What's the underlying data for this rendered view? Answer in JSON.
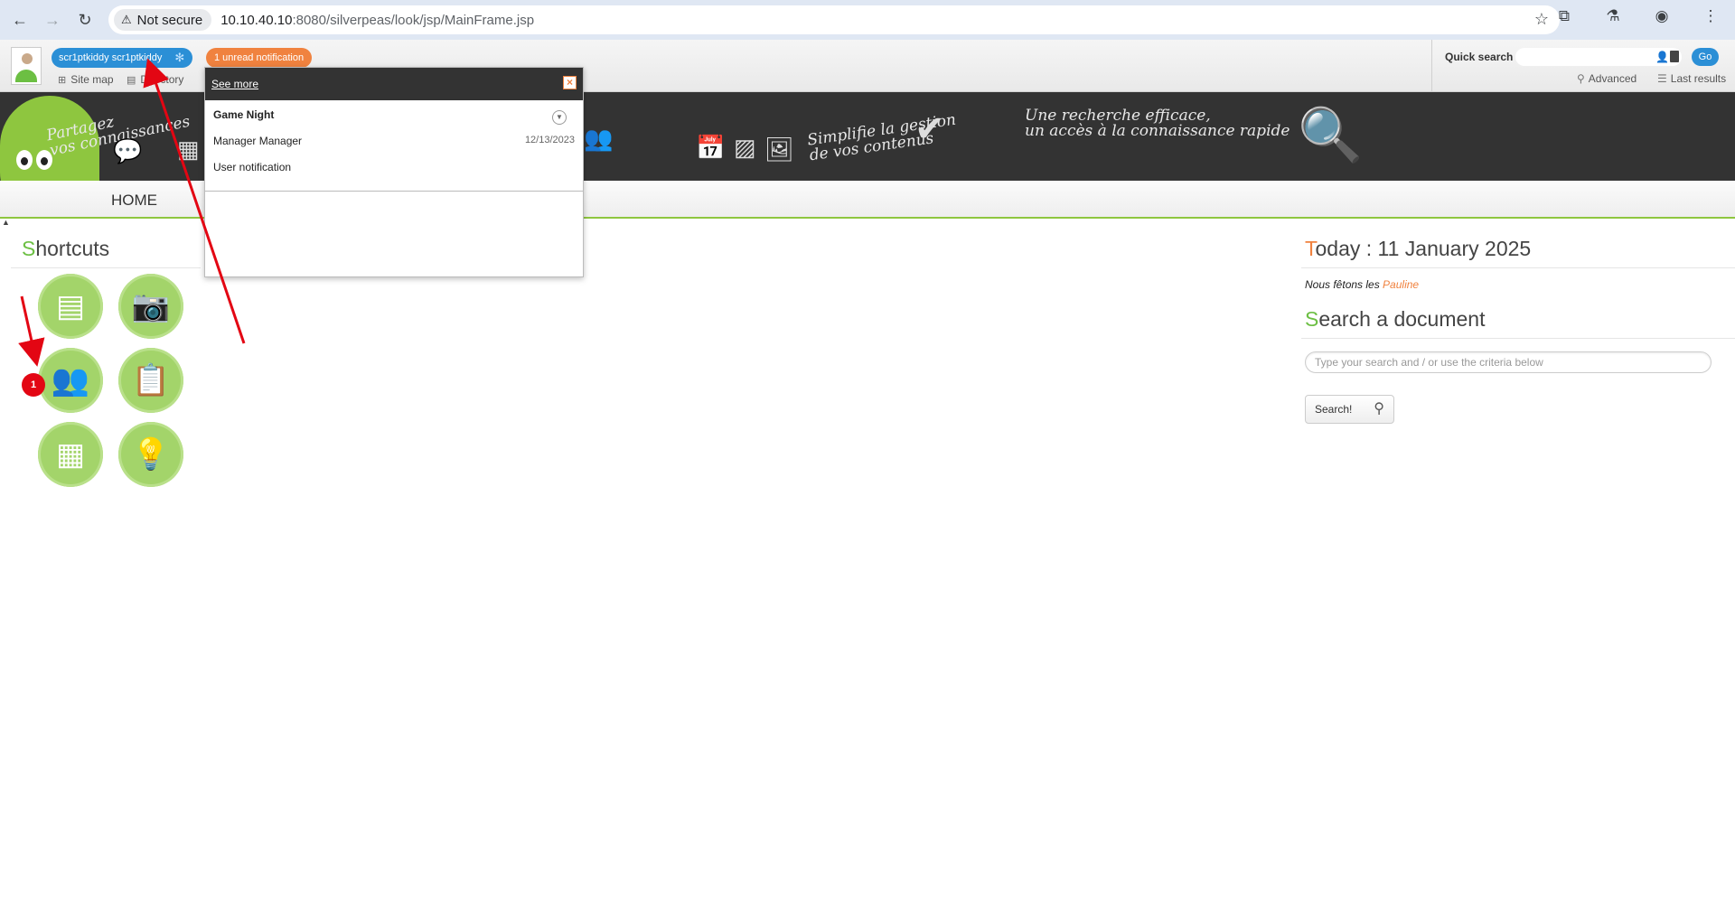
{
  "browser": {
    "security_label": "Not secure",
    "url_host": "10.10.40.10",
    "url_rest": ":8080/silverpeas/look/jsp/MainFrame.jsp"
  },
  "header": {
    "user_name": "scr1ptkiddy scr1ptkiddy",
    "notification_label": "1 unread notification",
    "site_map": "Site map",
    "directory": "Directory"
  },
  "quick_search": {
    "label": "Quick search",
    "go": "Go",
    "advanced": "Advanced",
    "last_results": "Last results"
  },
  "banner": {
    "slogan1_line1": "Partagez",
    "slogan1_line2": "vos connaissances",
    "slogan2_line1": "Simplifie la gestion",
    "slogan2_line2": "de vos contenus",
    "slogan3_line1": "Une recherche efficace,",
    "slogan3_line2": "un accès à la connaissance rapide"
  },
  "nav": {
    "home": "HOME"
  },
  "shortcuts": {
    "title_first": "S",
    "title_rest": "hortcuts",
    "badge_count": "1",
    "icons": [
      "books-icon",
      "camera-icon",
      "group-icon",
      "clipboard-icon",
      "calendar-building-icon",
      "lightbulb-icon"
    ]
  },
  "today": {
    "title_first": "T",
    "title_rest": "oday : 11 January 2025",
    "fete_prefix": "Nous fêtons les ",
    "fete_name": "Pauline"
  },
  "document_search": {
    "title_first": "S",
    "title_rest": "earch a document",
    "placeholder": "Type your search and / or use the criteria below",
    "button": "Search!"
  },
  "notification_popup": {
    "see_more": "See more",
    "title": "Game Night",
    "sender": "Manager Manager",
    "date": "12/13/2023",
    "type": "User notification"
  },
  "colors": {
    "accent_green": "#8ec63f",
    "accent_orange": "#f0823f",
    "pill_blue": "#2b8fd6",
    "annotation_red": "#e30613"
  }
}
